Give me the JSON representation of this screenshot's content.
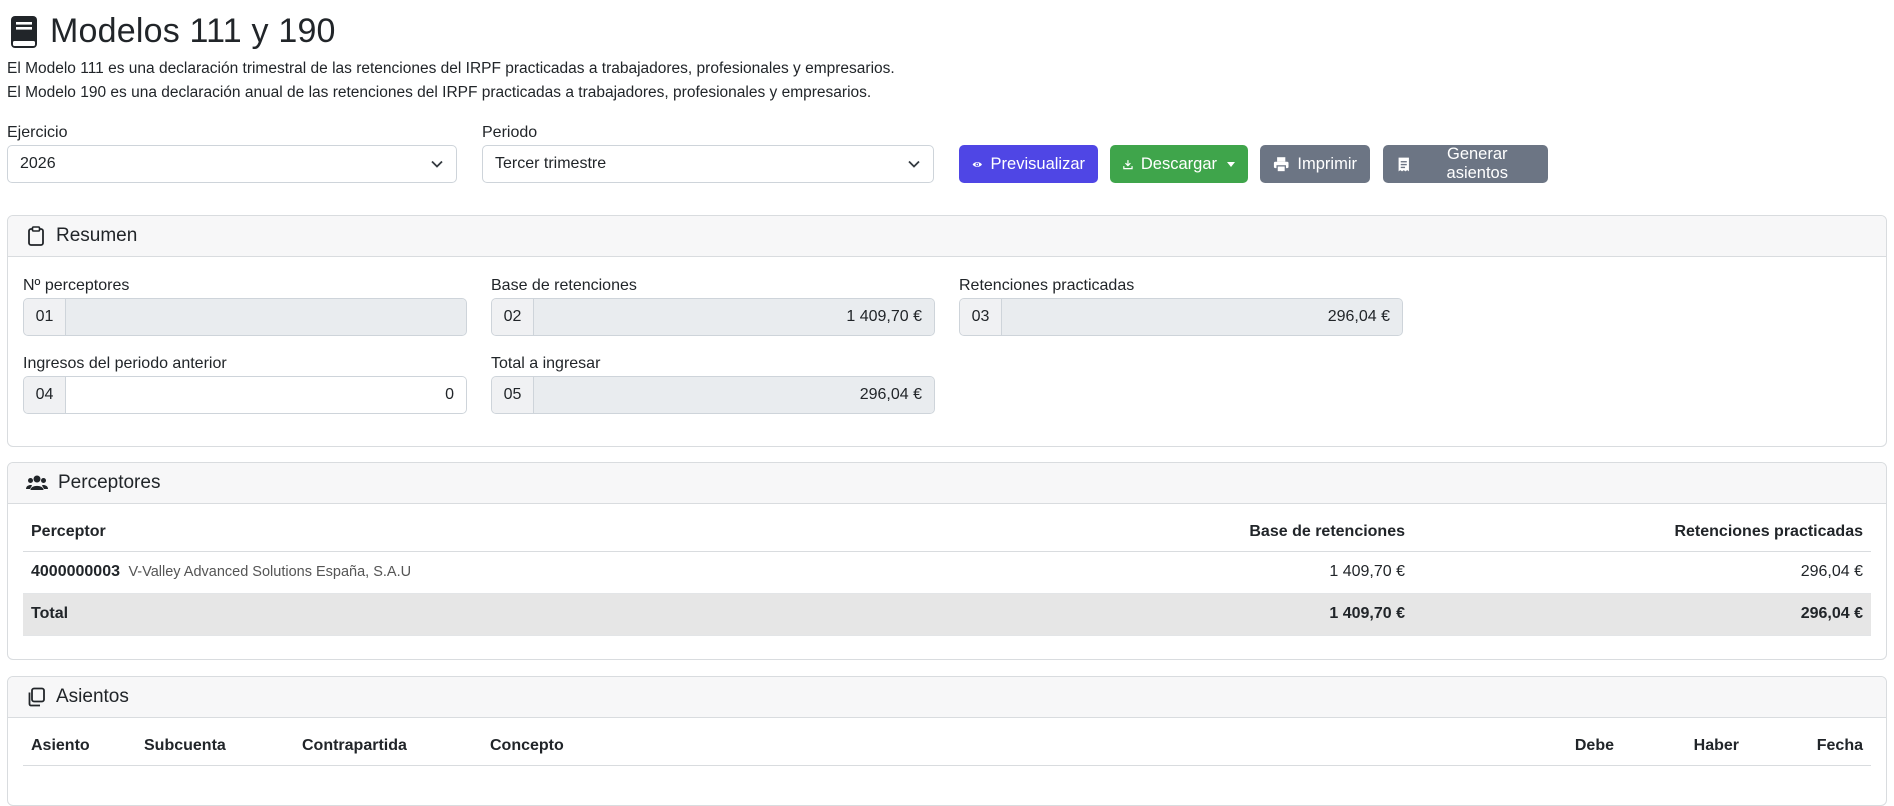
{
  "header": {
    "title": "Modelos 111 y 190",
    "desc1": "El Modelo 111 es una declaración trimestral de las retenciones del IRPF practicadas a trabajadores, profesionales y empresarios.",
    "desc2": "El Modelo 190 es una declaración anual de las retenciones del IRPF practicadas a trabajadores, profesionales y empresarios."
  },
  "filters": {
    "ejercicio_label": "Ejercicio",
    "ejercicio_value": "2026",
    "periodo_label": "Periodo",
    "periodo_value": "Tercer trimestre"
  },
  "toolbar": {
    "preview": "Previsualizar",
    "download": "Descargar",
    "print": "Imprimir",
    "generate": "Generar asientos"
  },
  "resumen": {
    "title": "Resumen",
    "fields": [
      {
        "label": "Nº perceptores",
        "code": "01",
        "value": ""
      },
      {
        "label": "Base de retenciones",
        "code": "02",
        "value": "1 409,70 €"
      },
      {
        "label": "Retenciones practicadas",
        "code": "03",
        "value": "296,04 €"
      },
      {
        "label": "Ingresos del periodo anterior",
        "code": "04",
        "value": "0"
      },
      {
        "label": "Total a ingresar",
        "code": "05",
        "value": "296,04 €"
      }
    ]
  },
  "perceptores": {
    "title": "Perceptores",
    "columns": [
      "Perceptor",
      "Base de retenciones",
      "Retenciones practicadas"
    ],
    "rows": [
      {
        "code": "4000000003",
        "name": "V-Valley Advanced Solutions España, S.A.U",
        "base": "1 409,70 €",
        "ret": "296,04 €"
      }
    ],
    "total": {
      "label": "Total",
      "base": "1 409,70 €",
      "ret": "296,04 €"
    }
  },
  "asientos": {
    "title": "Asientos",
    "columns": [
      "Asiento",
      "Subcuenta",
      "Contrapartida",
      "Concepto",
      "Debe",
      "Haber",
      "Fecha"
    ]
  },
  "colors": {
    "preview": "#4f46e5",
    "download": "#3fa54b",
    "secondary": "#6c7584"
  }
}
